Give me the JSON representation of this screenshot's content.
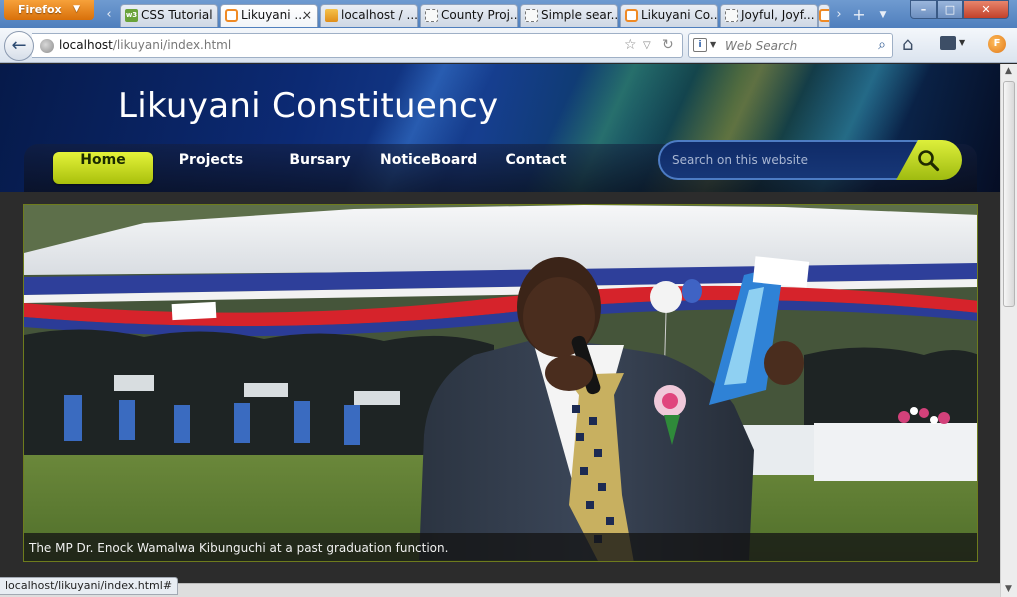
{
  "browser": {
    "menu_label": "Firefox",
    "tabs": [
      {
        "title": "CSS Tutorial",
        "icon": "w3schools-icon"
      },
      {
        "title": "Likuyani ...",
        "icon": "page-icon",
        "active": true
      },
      {
        "title": "localhost / ...",
        "icon": "phpmyadmin-icon"
      },
      {
        "title": "County Proj...",
        "icon": "blank-page-icon"
      },
      {
        "title": "Simple sear...",
        "icon": "blank-page-icon"
      },
      {
        "title": "Likuyani Co...",
        "icon": "page-icon"
      },
      {
        "title": "Joyful, Joyf...",
        "icon": "blank-page-icon"
      }
    ],
    "url_host": "localhost",
    "url_path": "/likuyani/index.html",
    "search_placeholder": "Web Search",
    "status_url": "localhost/likuyani/index.html#"
  },
  "site": {
    "title": "Likuyani Constituency",
    "nav": [
      "Home",
      "Projects",
      "Bursary",
      "NoticeBoard",
      "Contact"
    ],
    "active_nav": "Home",
    "search_placeholder": "Search on this website",
    "slideshow_caption": "The MP Dr. Enock Wamalwa Kibunguchi at a past graduation function."
  },
  "colors": {
    "accent_green": "#c9dc1d",
    "header_blue": "#0c2a74"
  }
}
